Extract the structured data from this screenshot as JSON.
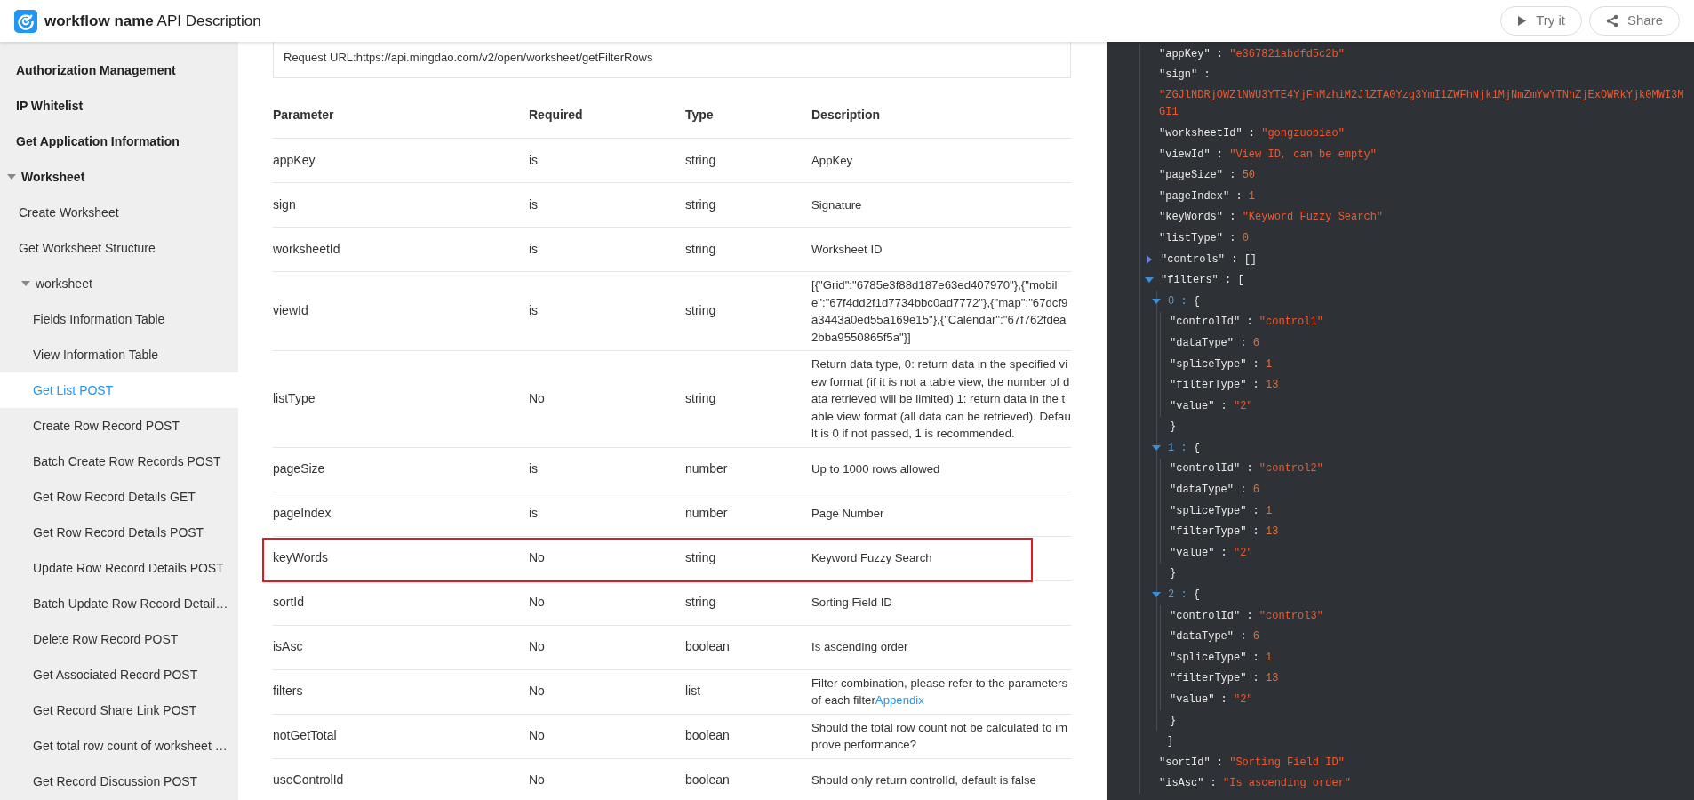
{
  "header": {
    "title": "**workflow name** API Description",
    "buttons": [
      {
        "kind": "play",
        "label": "Try it"
      },
      {
        "kind": "share",
        "label": "Share"
      }
    ]
  },
  "sidebar": {
    "items": [
      {
        "label": "Authorization Management",
        "selected": false
      },
      {
        "label": "IP Whitelist",
        "selected": false
      },
      {
        "label": "Get Application Information",
        "selected": false
      },
      {
        "label": "Worksheet",
        "selected": false,
        "expanded": true,
        "children": [
          {
            "label": "Create Worksheet",
            "selected": false
          },
          {
            "label": "Get Worksheet Structure",
            "selected": false
          },
          {
            "label": "worksheet",
            "selected": false,
            "expanded": true,
            "children": [
              {
                "label": "Fields Information Table",
                "selected": false
              },
              {
                "label": "View Information Table",
                "selected": false
              },
              {
                "label": "Get List POST",
                "selected": true
              },
              {
                "label": "Create Row Record POST",
                "selected": false
              },
              {
                "label": "Batch Create Row Records POST",
                "selected": false
              },
              {
                "label": "Get Row Record Details GET",
                "selected": false
              },
              {
                "label": "Get Row Record Details POST",
                "selected": false
              },
              {
                "label": "Update Row Record Details POST",
                "selected": false
              },
              {
                "label": "Batch Update Row Record Detail…",
                "selected": false
              },
              {
                "label": "Delete Row Record POST",
                "selected": false
              },
              {
                "label": "Get Associated Record POST",
                "selected": false
              },
              {
                "label": "Get Record Share Link POST",
                "selected": false
              },
              {
                "label": "Get total row count of worksheet …",
                "selected": false
              },
              {
                "label": "Get Record Discussion POST",
                "selected": false
              }
            ]
          }
        ]
      }
    ]
  },
  "request_url": "Request URL:https://api.mingdao.com/v2/open/worksheet/getFilterRows",
  "table": {
    "columns": [
      "Parameter",
      "Required",
      "Type",
      "Description"
    ],
    "rows": [
      {
        "parameter": "appKey",
        "required": "is",
        "type": "string",
        "description": "AppKey",
        "highlighted": false
      },
      {
        "parameter": "sign",
        "required": "is",
        "type": "string",
        "description": "Signature",
        "highlighted": false
      },
      {
        "parameter": "worksheetId",
        "required": "is",
        "type": "string",
        "description": "Worksheet ID",
        "highlighted": false
      },
      {
        "parameter": "viewId",
        "required": "is",
        "type": "string",
        "description": "[{\"Grid\":\"6785e3f88d187e63ed407970\"},{\"mobile\":\"67f4dd2f1d7734bbc0ad7772\"},{\"map\":\"67dcf9a3443a0ed55a169e15\"},{\"Calendar\":\"67f762fdea2bba9550865f5a\"}]",
        "highlighted": false
      },
      {
        "parameter": "listType",
        "required": "No",
        "type": "string",
        "description": "Return data type, 0: return data in the specified view format (if it is not a table view, the number of data retrieved will be limited) 1: return data in the table view format (all data can be retrieved). Default is 0 if not passed, 1 is recommended.",
        "highlighted": false
      },
      {
        "parameter": "pageSize",
        "required": "is",
        "type": "number",
        "description": "Up to 1000 rows allowed",
        "highlighted": false
      },
      {
        "parameter": "pageIndex",
        "required": "is",
        "type": "number",
        "description": "Page Number",
        "highlighted": false
      },
      {
        "parameter": "keyWords",
        "required": "No",
        "type": "string",
        "description": "Keyword Fuzzy Search",
        "highlighted": true
      },
      {
        "parameter": "sortId",
        "required": "No",
        "type": "string",
        "description": "Sorting Field ID",
        "highlighted": false
      },
      {
        "parameter": "isAsc",
        "required": "No",
        "type": "boolean",
        "description": "Is ascending order",
        "highlighted": false
      },
      {
        "parameter": "filters",
        "required": "No",
        "type": "list",
        "description": "Filter combination, please refer to the parameters of each filter",
        "link": "Appendix",
        "highlighted": false
      },
      {
        "parameter": "notGetTotal",
        "required": "No",
        "type": "boolean",
        "description": "Should the total row count not be calculated to improve performance?",
        "highlighted": false
      },
      {
        "parameter": "useControlId",
        "required": "No",
        "type": "boolean",
        "description": "Should only return controlId, default is false",
        "highlighted": false
      }
    ]
  },
  "code": {
    "lines": [
      {
        "kind": "string",
        "key": "\"appKey\" :",
        "value": "\"e367821abdfd5c2b\""
      },
      {
        "kind": "block-string",
        "key": "\"sign\" :",
        "value": "\"ZGJlNDRjOWZlNWU3YTE4YjFhMzhiM2JlZTA0Yzg3YmI1ZWFhNjk1MjNmZmYwYTNhZjExOWRkYjk0MWI3MGI1"
      },
      {
        "kind": "string",
        "key": "\"worksheetId\" :",
        "value": "\"gongzuobiao\""
      },
      {
        "kind": "string",
        "key": "\"viewId\" :",
        "value": "\"View ID, can be empty\""
      },
      {
        "kind": "number",
        "key": "\"pageSize\" :",
        "value": "50"
      },
      {
        "kind": "number",
        "key": "\"pageIndex\" :",
        "value": "1"
      },
      {
        "kind": "string",
        "key": "\"keyWords\" :",
        "value": "\"Keyword Fuzzy Search\""
      },
      {
        "kind": "number",
        "key": "\"listType\" :",
        "value": "0"
      },
      {
        "kind": "array",
        "key": "\"controls\" :",
        "open": "[]",
        "expanded": false
      },
      {
        "kind": "array",
        "key": "\"filters\" :",
        "open": "[",
        "close": "]",
        "expanded": true,
        "children": [
          {
            "kind": "object",
            "key": "0 :",
            "open": "{",
            "close": "}",
            "expanded": true,
            "children": [
              {
                "kind": "string",
                "key": "\"controlId\" :",
                "value": "\"control1\""
              },
              {
                "kind": "number",
                "key": "\"dataType\" :",
                "value": "6"
              },
              {
                "kind": "number",
                "key": "\"spliceType\" :",
                "value": "1"
              },
              {
                "kind": "number",
                "key": "\"filterType\" :",
                "value": "13"
              },
              {
                "kind": "string",
                "key": "\"value\" :",
                "value": "\"2\""
              }
            ]
          },
          {
            "kind": "object",
            "key": "1 :",
            "open": "{",
            "close": "}",
            "expanded": true,
            "children": [
              {
                "kind": "string",
                "key": "\"controlId\" :",
                "value": "\"control2\""
              },
              {
                "kind": "number",
                "key": "\"dataType\" :",
                "value": "6"
              },
              {
                "kind": "number",
                "key": "\"spliceType\" :",
                "value": "1"
              },
              {
                "kind": "number",
                "key": "\"filterType\" :",
                "value": "13"
              },
              {
                "kind": "string",
                "key": "\"value\" :",
                "value": "\"2\""
              }
            ]
          },
          {
            "kind": "object",
            "key": "2 :",
            "open": "{",
            "close": "}",
            "expanded": true,
            "children": [
              {
                "kind": "string",
                "key": "\"controlId\" :",
                "value": "\"control3\""
              },
              {
                "kind": "number",
                "key": "\"dataType\" :",
                "value": "6"
              },
              {
                "kind": "number",
                "key": "\"spliceType\" :",
                "value": "1"
              },
              {
                "kind": "number",
                "key": "\"filterType\" :",
                "value": "13"
              },
              {
                "kind": "string",
                "key": "\"value\" :",
                "value": "\"2\""
              }
            ]
          }
        ]
      },
      {
        "kind": "string",
        "key": "\"sortId\" :",
        "value": "\"Sorting Field ID\""
      },
      {
        "kind": "string",
        "key": "\"isAsc\" :",
        "value": "\"Is ascending order\""
      }
    ]
  }
}
